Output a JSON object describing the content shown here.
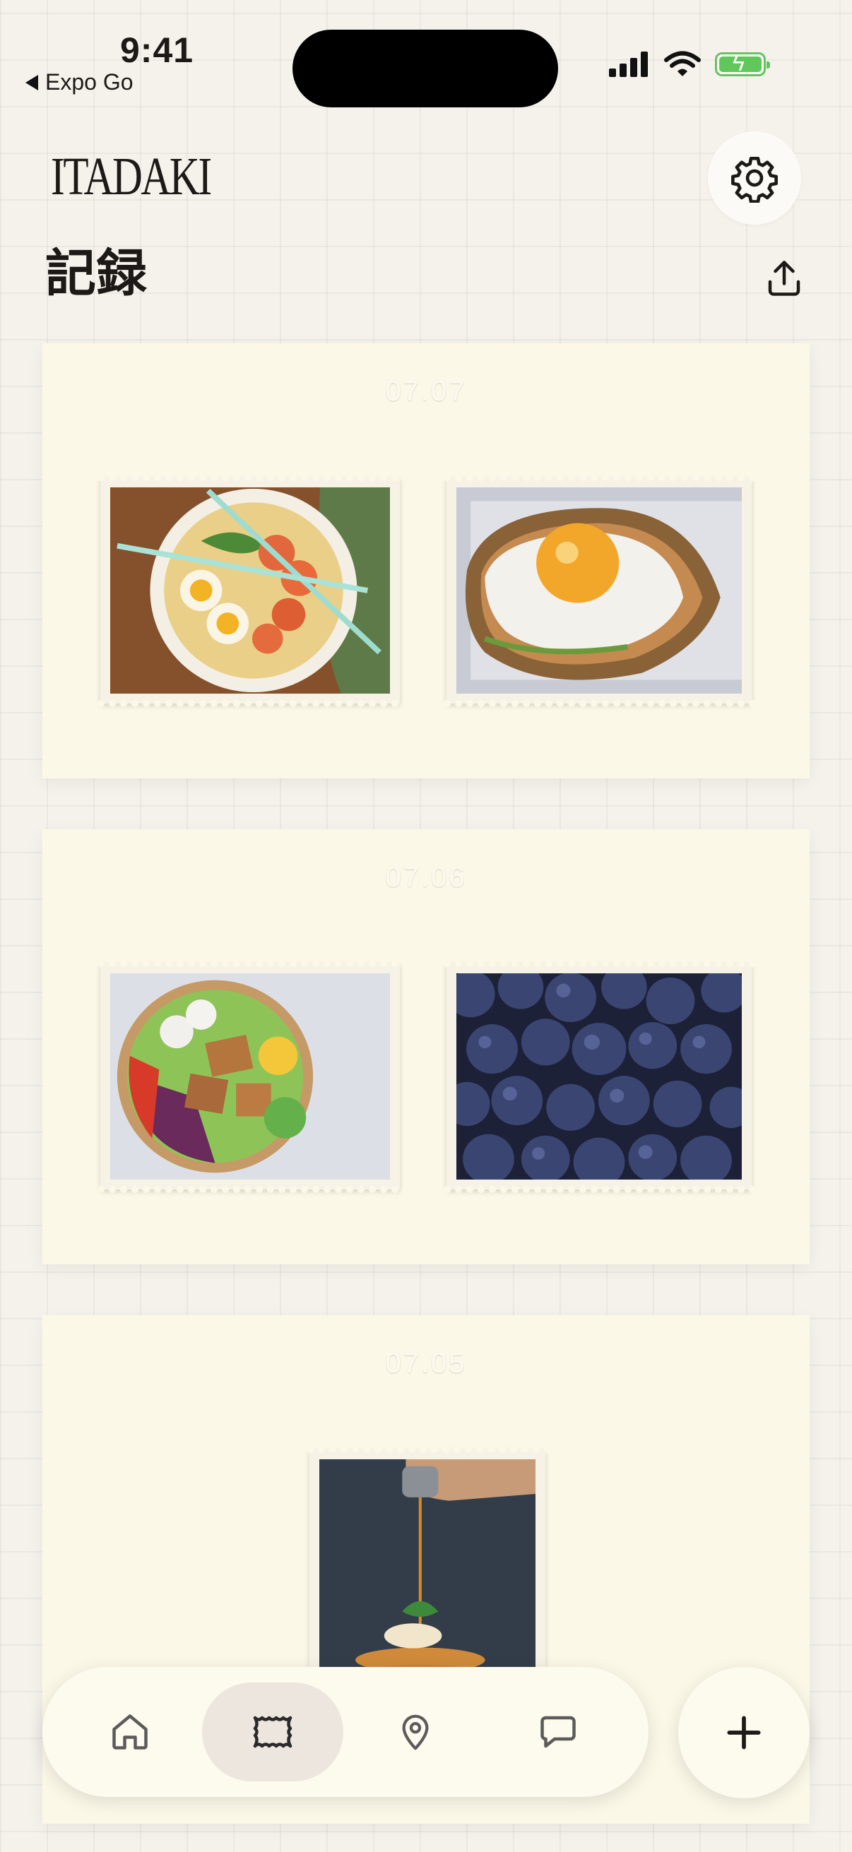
{
  "status": {
    "time": "9:41",
    "back_label": "Expo Go"
  },
  "header": {
    "logo": "ITADAKI",
    "title": "記録",
    "settings_icon": "gear-icon",
    "share_icon": "share-icon"
  },
  "days": [
    {
      "date": "07.07",
      "photos": [
        "ramen",
        "fried-egg-toast"
      ]
    },
    {
      "date": "07.06",
      "photos": [
        "salmon-salad-bowl",
        "blueberries"
      ]
    },
    {
      "date": "07.05",
      "photos": [
        "pancakes"
      ]
    }
  ],
  "tabbar": {
    "tabs": [
      {
        "icon": "home-icon",
        "active": false
      },
      {
        "icon": "stamp-icon",
        "active": true
      },
      {
        "icon": "map-pin-icon",
        "active": false
      },
      {
        "icon": "chat-icon",
        "active": false
      }
    ],
    "add_icon": "plus-icon"
  },
  "colors": {
    "card": "#fcf8e8",
    "background": "#f5f2ec",
    "active_tab": "#ece6df",
    "text": "#1c1a17"
  }
}
